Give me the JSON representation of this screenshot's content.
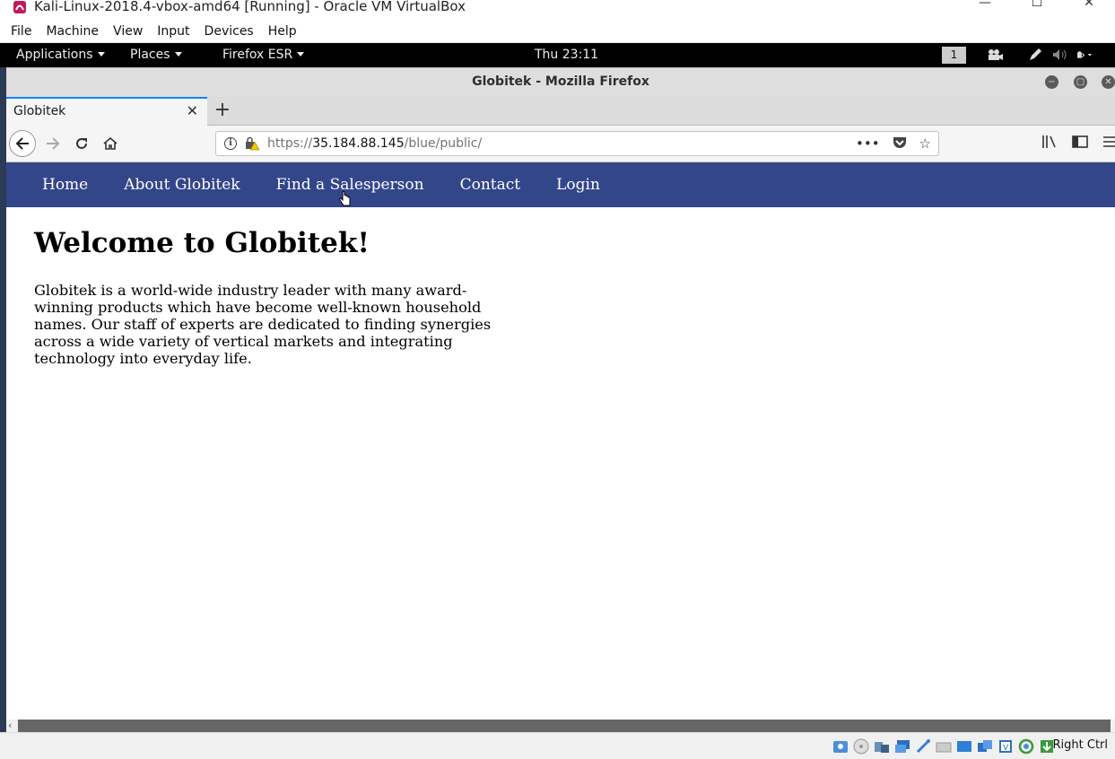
{
  "host_window": {
    "title": "Kali-Linux-2018.4-vbox-amd64 [Running] - Oracle VM VirtualBox",
    "controls": {
      "minimize": "—",
      "maximize": "☐",
      "close": "✕"
    }
  },
  "vbox_menu": [
    "File",
    "Machine",
    "View",
    "Input",
    "Devices",
    "Help"
  ],
  "gnome_panel": {
    "applications": "Applications",
    "places": "Places",
    "active_app": "Firefox ESR",
    "clock": "Thu 23:11",
    "workspace": "1"
  },
  "firefox": {
    "window_title": "Globitek - Mozilla Firefox",
    "tab_title": "Globitek",
    "new_tab": "+",
    "url_prefix": "https://",
    "url_host": "35.184.88.145",
    "url_path": "/blue/public/"
  },
  "site": {
    "nav": [
      "Home",
      "About Globitek",
      "Find a Salesperson",
      "Contact",
      "Login"
    ],
    "heading": "Welcome to Globitek!",
    "intro": "Globitek is a world-wide industry leader with many award-winning products which have become well-known household names. Our staff of experts are dedicated to finding synergies across a wide variety of vertical markets and integrating technology into everyday life."
  },
  "status_bar": {
    "host_key": "Right Ctrl"
  },
  "colors": {
    "site_nav_bg": "#34468a",
    "tab_accent": "#0a84ff",
    "gnome_panel_bg": "#000000"
  }
}
